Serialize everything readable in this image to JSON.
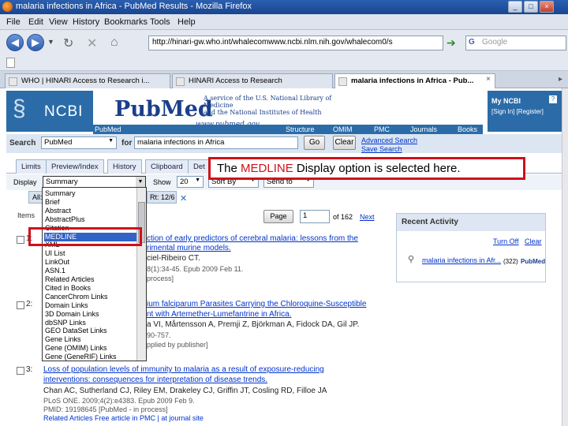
{
  "window": {
    "title": "malaria infections in Africa - PubMed Results - Mozilla Firefox",
    "controls": [
      "_",
      "□",
      "×"
    ]
  },
  "menubar": [
    "File",
    "Edit",
    "View",
    "History",
    "Bookmarks",
    "Tools",
    "Help"
  ],
  "toolbar": {
    "url": "http://hinari-gw.who.int/whalecomwww.ncbi.nlm.nih.gov/whalecom0/s",
    "search_placeholder": "Google"
  },
  "tabs": [
    {
      "label": "WHO | HINARI Access to Research i..."
    },
    {
      "label": "HINARI Access to Research"
    },
    {
      "label": "malaria infections in Africa - Pub..."
    }
  ],
  "header": {
    "ncbi": "NCBI",
    "pubmed": "PubMed",
    "pubmed_url": "www.pubmed.gov",
    "service_line1": "A service of the U.S. National Library of Medicine",
    "service_line2": "and the National Institutes of Health",
    "myncbi": "My NCBI",
    "signin": "Sign In] [Register]",
    "nav": [
      "PubMed",
      "Structure",
      "OMIM",
      "PMC",
      "Journals",
      "Books"
    ]
  },
  "search": {
    "label": "Search",
    "db": "PubMed",
    "for": "for",
    "query": "malaria infections in Africa",
    "go": "Go",
    "clear": "Clear",
    "advanced": "Advanced Search",
    "saved": "Save Search"
  },
  "pubtabs": [
    "Limits",
    "Preview/Index",
    "History",
    "Clipboard",
    "Det"
  ],
  "display": {
    "label": "Display",
    "value": "Summary",
    "show": "Show",
    "count": "20",
    "sort": "Sort By",
    "send": "Send to"
  },
  "results_tab": "All: 32",
  "results_tab2": "Rt: 12/6",
  "items_label": "Items",
  "pager": {
    "page_btn": "Page",
    "page": "1",
    "of": "of 162",
    "next": "Next"
  },
  "callout": {
    "pre": "The ",
    "hl": "MEDLINE",
    "post": " Display option is selected here."
  },
  "dropdown": [
    "Summary",
    "Brief",
    "Abstract",
    "AbstractPlus",
    "Citation",
    "MEDLINE",
    "XML",
    "UI List",
    "LinkOut",
    "ASN.1",
    "Related Articles",
    "Cited in Books",
    "CancerChrom Links",
    "Domain Links",
    "3D Domain Links",
    "dbSNP Links",
    "GEO DataSet Links",
    "Gene Links",
    "Gene (OMIM) Links",
    "Gene (GeneRIF) Links"
  ],
  "dropdown_selected": "MEDLINE",
  "activity": {
    "title": "Recent Activity",
    "turn_off": "Turn Off",
    "clear": "Clear",
    "item": "malaria infections in Afr...",
    "item_count": "(322)",
    "item_db": "PubMed"
  },
  "results": [
    {
      "num": "1:",
      "title_l1": "ction of early predictors of cerebral malaria: lessons from the",
      "title_l2": "rimental murine models.",
      "authors": "ciel-Ribeiro CT.",
      "cite": "8(1):34-45. Epub 2009 Feb 11.",
      "status": "process]"
    },
    {
      "num": "2:",
      "title_l1": "ium falciparum Parasites Carrying the Chloroquine-Susceptible",
      "title_l2": "nt with Artemether-Lumefantrine in Africa.",
      "authors": "a VI, Mårtensson A, Premji Z, Björkman A, Fidock DA, Gil JP.",
      "cite": "90-757.",
      "status": "pplied by publisher]"
    },
    {
      "num": "3:",
      "title_l1": "Loss of population levels of immunity to malaria as a result of exposure-reducing",
      "title_l2": "interventions: consequences for interpretation of disease trends.",
      "authors": "Chan AC, Sutherland CJ, Riley EM, Drakeley CJ, Griffin JT, Cosling RD, Filloe JA",
      "cite": "PLoS ONE. 2009;4(2):e4383. Epub 2009 Feb 9.",
      "pmid": "PMID: 19198645 [PubMed - in process]",
      "links": "Related Articles   Free article in PMC | at journal site"
    }
  ]
}
